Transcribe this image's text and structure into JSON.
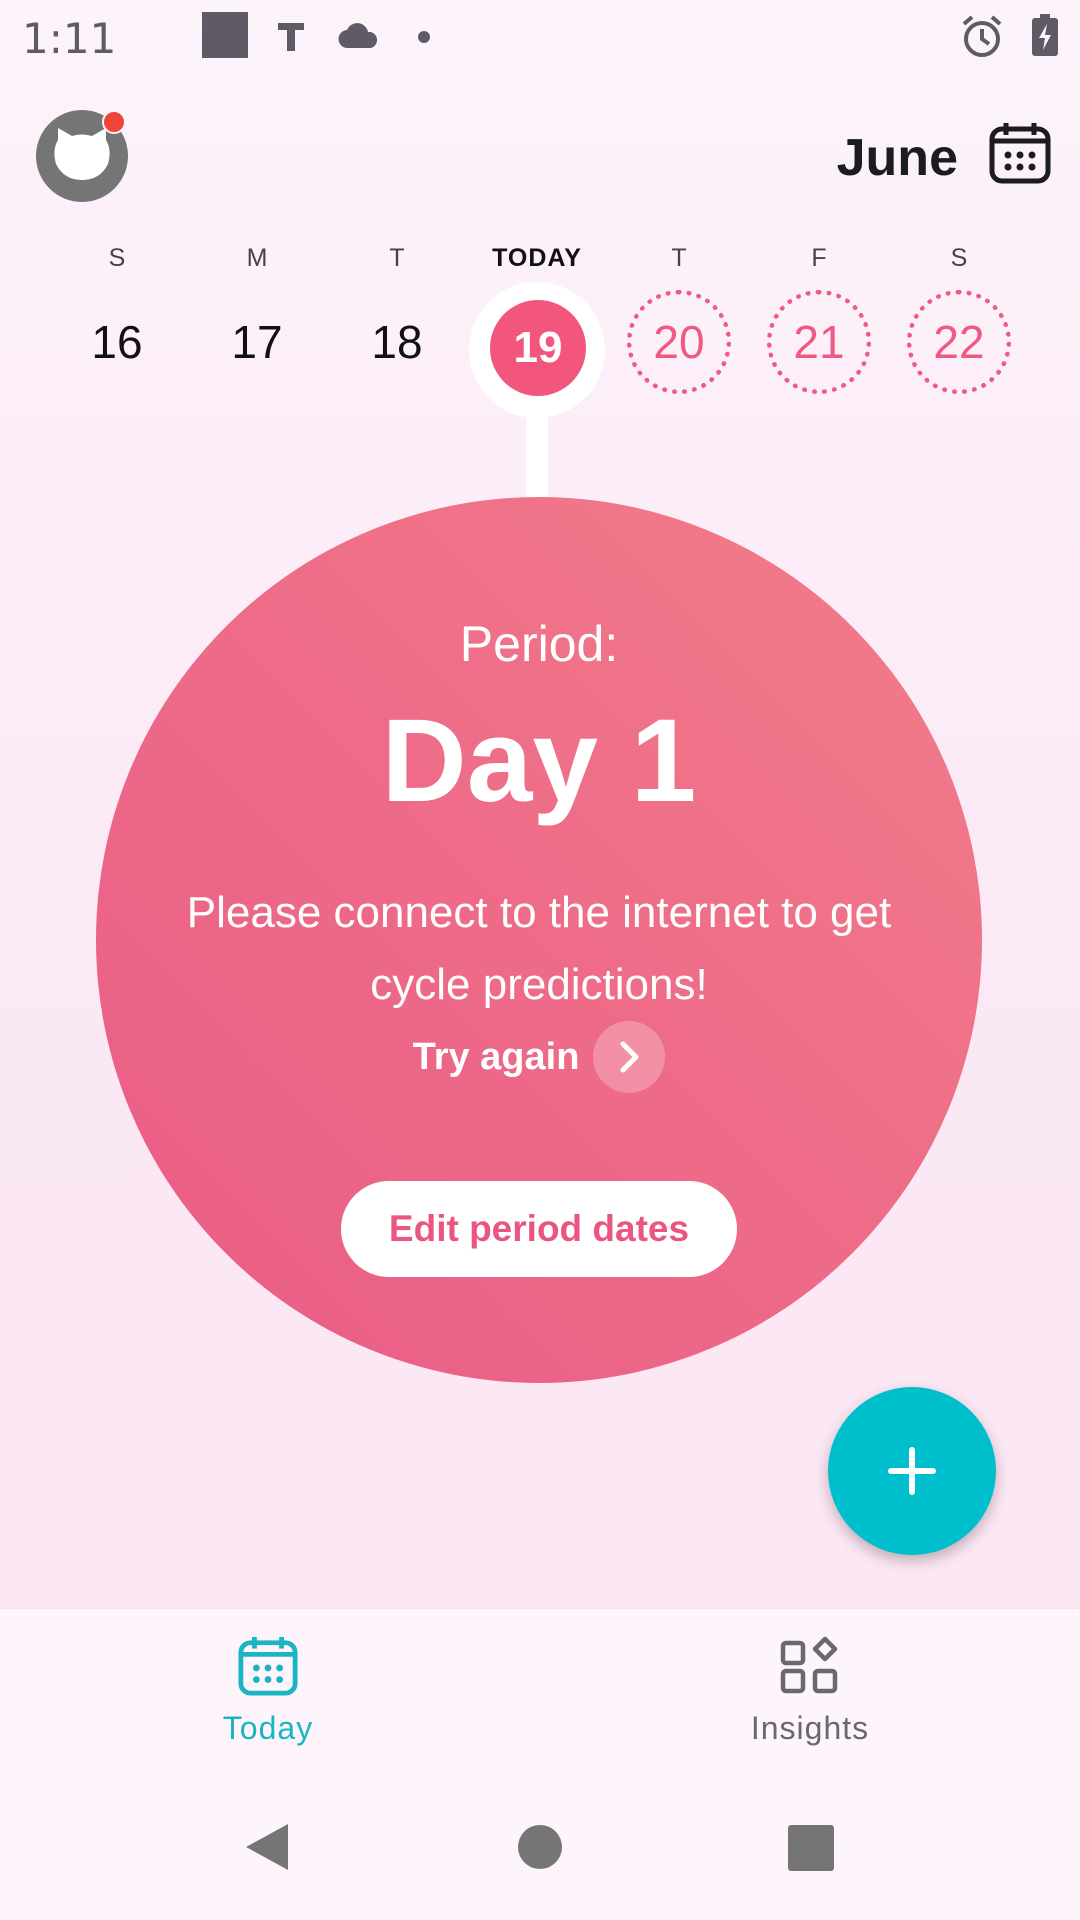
{
  "status_bar": {
    "time": "1:11",
    "icons": [
      "square-icon",
      "t-icon",
      "cloud-icon",
      "dot-icon",
      "alarm-icon",
      "battery-icon"
    ]
  },
  "header": {
    "month": "June",
    "calendar_icon": "calendar-icon",
    "avatar_icon": "cat-avatar-icon"
  },
  "week": {
    "days": [
      {
        "letter": "S",
        "number": "16",
        "state": "past"
      },
      {
        "letter": "M",
        "number": "17",
        "state": "past"
      },
      {
        "letter": "T",
        "number": "18",
        "state": "past"
      },
      {
        "letter": "TODAY",
        "number": "19",
        "state": "today"
      },
      {
        "letter": "T",
        "number": "20",
        "state": "predicted"
      },
      {
        "letter": "F",
        "number": "21",
        "state": "predicted"
      },
      {
        "letter": "S",
        "number": "22",
        "state": "predicted"
      }
    ]
  },
  "cycle": {
    "period_label": "Period:",
    "day_count": "Day 1",
    "message": "Please connect to the internet to get cycle predictions!",
    "try_again_label": "Try again",
    "edit_button_label": "Edit period dates"
  },
  "fab": {
    "icon": "plus-icon"
  },
  "bottom_nav": {
    "items": [
      {
        "label": "Today",
        "icon": "calendar-icon",
        "active": true
      },
      {
        "label": "Insights",
        "icon": "grid-diamond-icon",
        "active": false
      }
    ]
  },
  "system_nav": {
    "icons": [
      "back-icon",
      "home-icon",
      "recents-icon"
    ]
  },
  "colors": {
    "accent_pink": "#f2567c",
    "circle_pink": "#ee6d88",
    "teal": "#00bfcc"
  }
}
